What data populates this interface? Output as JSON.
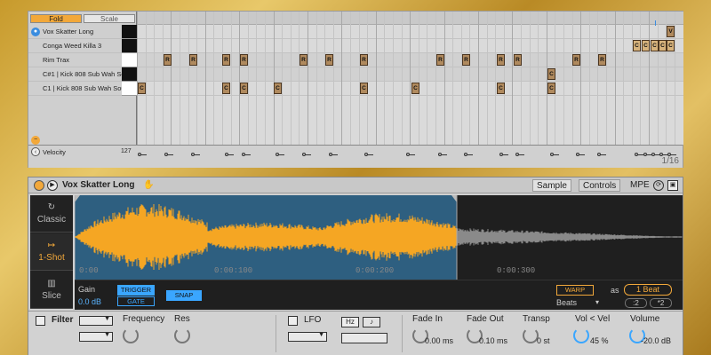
{
  "roll": {
    "fold_label": "Fold",
    "scale_label": "Scale",
    "lanes": [
      {
        "label": "Vox Skatter Long",
        "key": "black"
      },
      {
        "label": "Conga Weed Killa 3",
        "key": "black"
      },
      {
        "label": "Rim Trax",
        "key": "white"
      },
      {
        "label": "C#1 | Kick 808 Sub Wah Sou",
        "key": "black"
      },
      {
        "label": "C1 | Kick 808 Sub Wah Sou",
        "key": "white"
      }
    ],
    "velocity_label": "Velocity",
    "velocity_max": "127",
    "page_indicator": "1/16"
  },
  "device": {
    "name": "Vox Skatter Long",
    "tabs": {
      "sample": "Sample",
      "controls": "Controls"
    },
    "mpe_label": "MPE",
    "modes": {
      "classic": "Classic",
      "one_shot": "1-Shot",
      "slice": "Slice"
    },
    "time_labels": [
      "0:00",
      "0:00:100",
      "0:00:200",
      "0:00:300"
    ],
    "gain_label": "Gain",
    "gain_value": "0.0 dB",
    "trigger_label": "TRIGGER",
    "gate_label": "GATE",
    "snap_label": "SNAP",
    "warp_label": "WARP",
    "as_label": "as",
    "beat_value": "1 Beat",
    "beats_mode": "Beats",
    "half_label": ":2",
    "double_label": "*2",
    "filter_label": "Filter",
    "frequency_label": "Frequency",
    "res_label": "Res",
    "lfo_label": "LFO",
    "hz_label": "Hz",
    "note_label": "♪",
    "fade_in_label": "Fade In",
    "fade_in_value": "0.00 ms",
    "fade_out_label": "Fade Out",
    "fade_out_value": "0.10 ms",
    "transp_label": "Transp",
    "transp_value": "0 st",
    "vol_vel_label": "Vol < Vel",
    "vol_vel_value": "45 %",
    "volume_label": "Volume",
    "volume_value": "-20.0 dB"
  },
  "colors": {
    "accent": "#f2a83a",
    "blue": "#3aa6ff",
    "waveform": "#f5a623",
    "waveform_tail": "#8a8a8a"
  }
}
